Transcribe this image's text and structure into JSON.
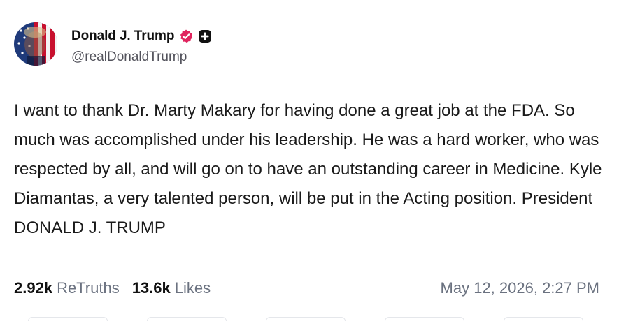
{
  "author": {
    "display_name": "Donald J. Trump",
    "handle": "@realDonaldTrump",
    "verified_badge_color": "#e0245e",
    "plus_badge_color": "#111111"
  },
  "post": {
    "text": "I want to thank Dr. Marty Makary for having done a great job at the FDA. So much was accomplished under his leadership. He was a hard worker, who was respected by all, and will go on to have an outstanding career in Medicine. Kyle Diamantas, a very talented person, will be put in the Acting position. President DONALD J. TRUMP"
  },
  "stats": {
    "retruths_count": "2.92k",
    "retruths_label": "ReTruths",
    "likes_count": "13.6k",
    "likes_label": "Likes"
  },
  "timestamp": "May 12, 2026, 2:27 PM",
  "icons": {
    "verified": "verified-icon",
    "plus": "plus-icon"
  }
}
